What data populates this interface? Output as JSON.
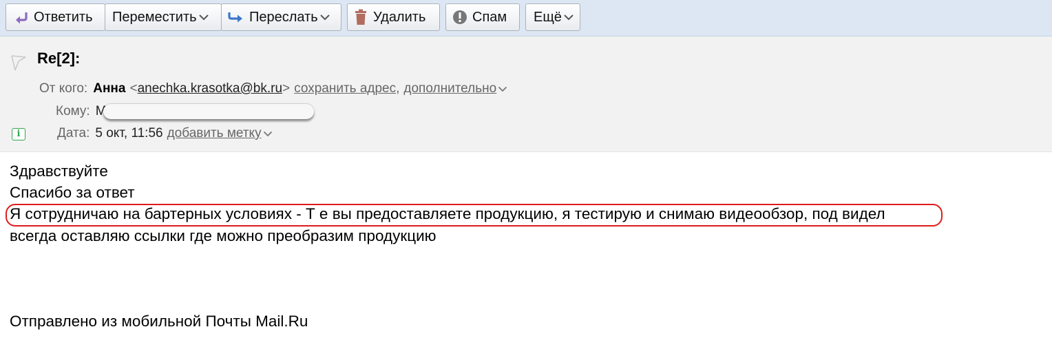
{
  "toolbar": {
    "reply": "Ответить",
    "move": "Переместить",
    "forward": "Переслать",
    "delete": "Удалить",
    "spam": "Спам",
    "more": "Ещё"
  },
  "message": {
    "subject": "Re[2]:",
    "from_label": "От кого:",
    "from_name": "Анна",
    "from_email": "anechka.krasotka@bk.ru",
    "save_address": "сохранить адрес",
    "more_link": "дополнительно",
    "to_label": "Кому:",
    "to_visible_fragment": "М",
    "date_label": "Дата:",
    "date": "5 окт, 11:56",
    "add_label": "добавить метку",
    "body": {
      "line1": "Здравствуйте",
      "line2": "Спасибо за ответ",
      "line3": "Я сотрудничаю на бартерных условиях - Т е вы предоставляете продукцию, я тестирую и снимаю видеообзор, под видел",
      "line4": "всегда оставляю ссылки где можно преобразим продукцию",
      "signature": "Отправлено из мобильной Почты Mail.Ru"
    }
  },
  "colors": {
    "toolbar_bg": "#dde6f3",
    "header_bg": "#f2f2f2",
    "highlight": "#e01b1b",
    "reply_icon": "#8e6bbf",
    "forward_icon": "#3a78c9",
    "delete_icon": "#b26d5e",
    "info_icon": "#2fa84f"
  }
}
